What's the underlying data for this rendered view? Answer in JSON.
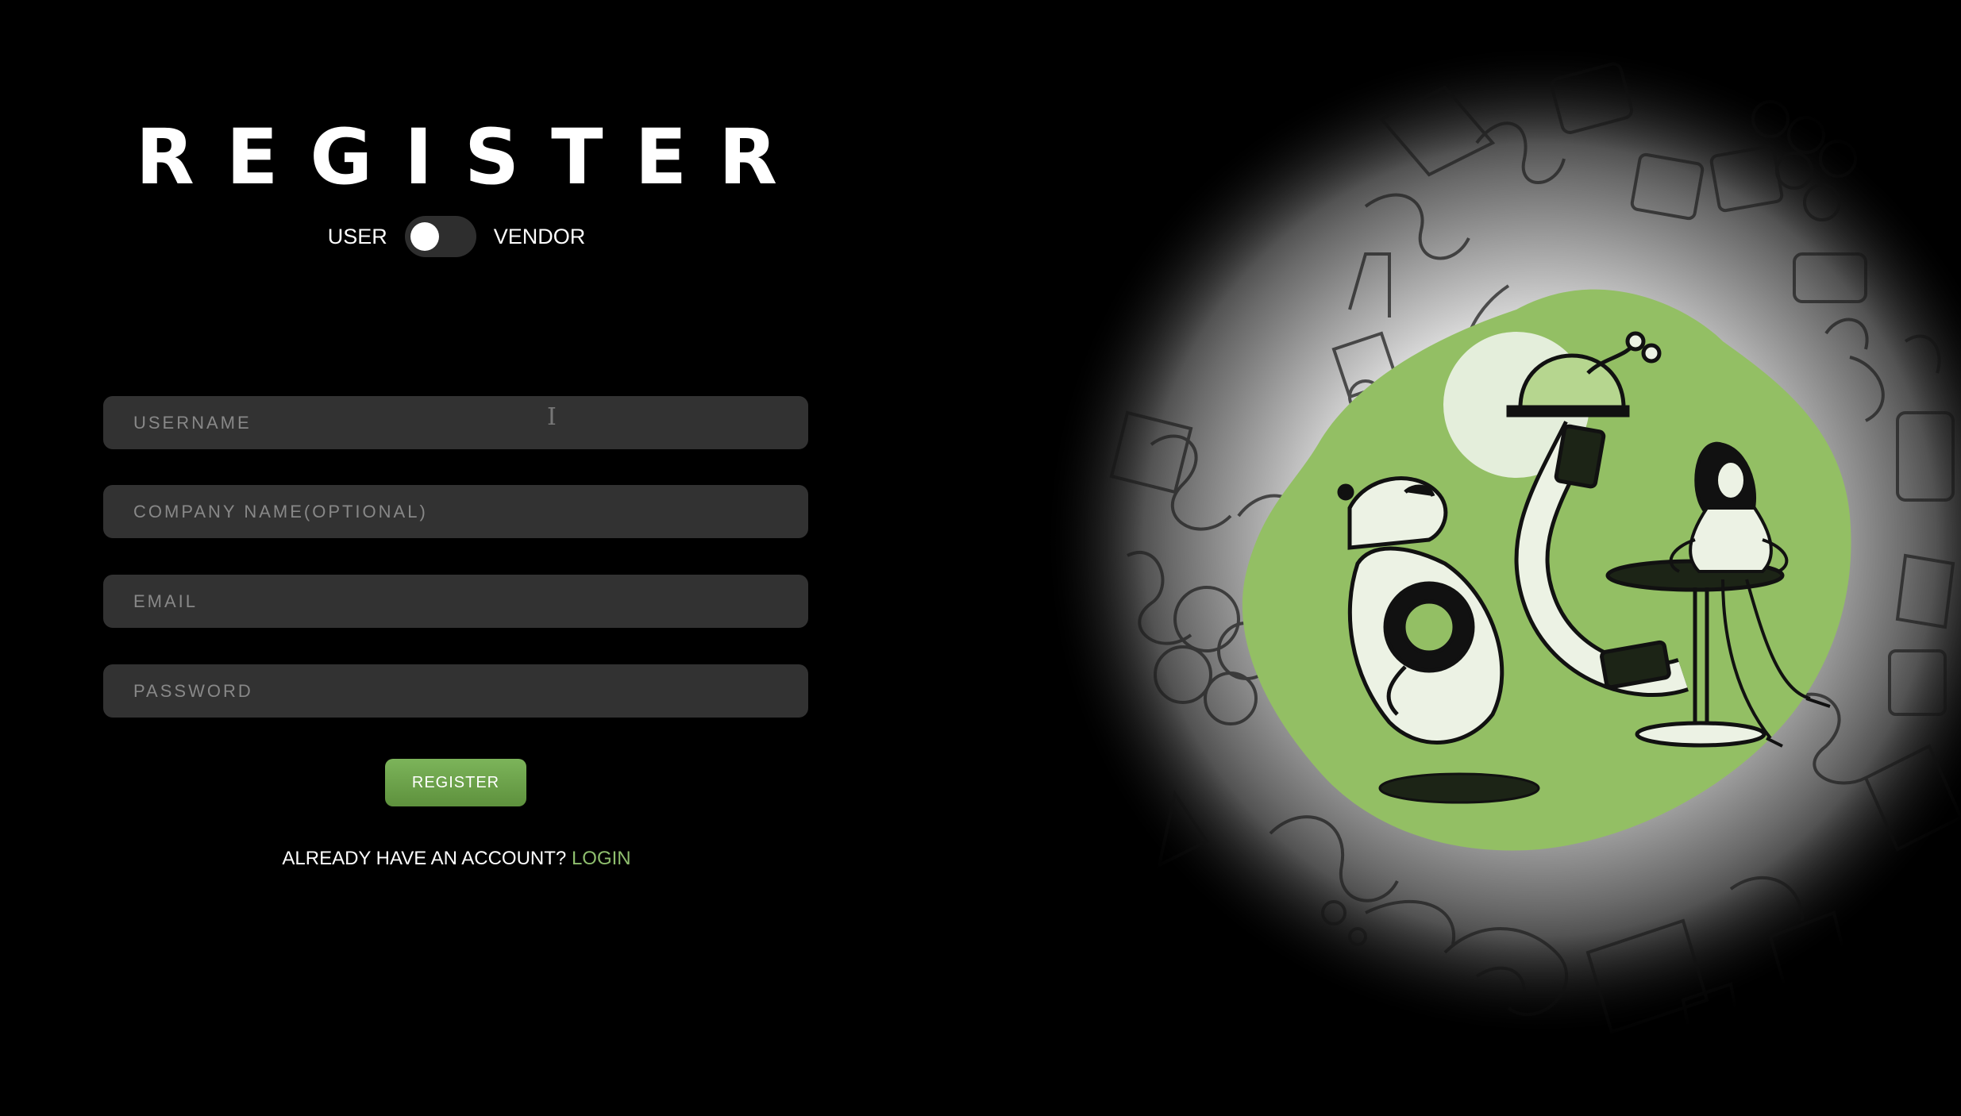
{
  "title": "REGISTER",
  "role_toggle": {
    "left_label": "USER",
    "right_label": "VENDOR",
    "selected": "USER"
  },
  "fields": {
    "username_placeholder": "USERNAME",
    "company_placeholder": "COMPANY NAME(OPTIONAL)",
    "email_placeholder": "EMAIL",
    "password_placeholder": "PASSWORD"
  },
  "register_button": "REGISTER",
  "login_prompt": {
    "text": "ALREADY HAVE AN ACCOUNT?",
    "link": "LOGIN"
  },
  "colors": {
    "accent_green": "#8fbf6e",
    "button_green": "#6ea44b",
    "field_bg": "#323232",
    "background": "#000000"
  },
  "icons": {
    "cursor": "text-cursor-icon"
  }
}
